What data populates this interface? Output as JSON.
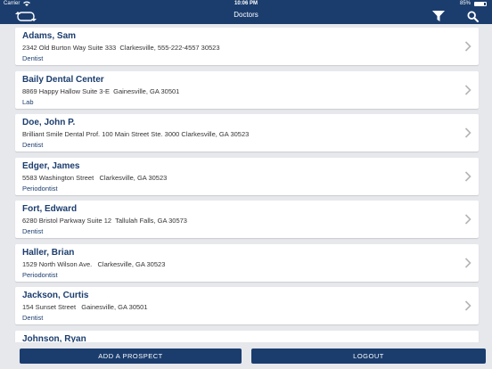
{
  "status_bar": {
    "carrier": "Carrier",
    "time": "10:06 PM",
    "battery_percent": "85%",
    "battery_level": 0.85
  },
  "nav": {
    "title": "Doctors",
    "icons": {
      "left": "sync-icon",
      "filter": "filter-icon",
      "search": "search-icon"
    }
  },
  "doctors": [
    {
      "name": "Adams, Sam",
      "address": "2342 Old Burton Way Suite 333  Clarkesville, 555-222-4557 30523",
      "type": "Dentist"
    },
    {
      "name": "Baily Dental Center",
      "address": "8869 Happy Hallow Suite 3-E  Gainesville, GA 30501",
      "type": "Lab"
    },
    {
      "name": "Doe, John P.",
      "address": "Brilliant Smile Dental Prof. 100 Main Street Ste. 3000 Clarkesville, GA 30523",
      "type": "Dentist"
    },
    {
      "name": "Edger, James",
      "address": "5583 Washington Street   Clarkesville, GA 30523",
      "type": "Periodontist"
    },
    {
      "name": "Fort, Edward",
      "address": "6280 Bristol Parkway Suite 12  Tallulah Falls, GA 30573",
      "type": "Dentist"
    },
    {
      "name": "Haller, Brian",
      "address": "1529 North Wilson Ave.   Clarkesville, GA 30523",
      "type": "Periodontist"
    },
    {
      "name": "Jackson, Curtis",
      "address": "154 Sunset Street   Gainesville, GA 30501",
      "type": "Dentist"
    },
    {
      "name": "Johnson, Ryan",
      "address": "",
      "type": ""
    }
  ],
  "buttons": {
    "add_prospect": "ADD A PROSPECT",
    "logout": "LOGOUT"
  },
  "colors": {
    "primary": "#1b3d6e",
    "background": "#e6e8ec",
    "card": "#ffffff",
    "chevron": "#b5b5b5"
  }
}
